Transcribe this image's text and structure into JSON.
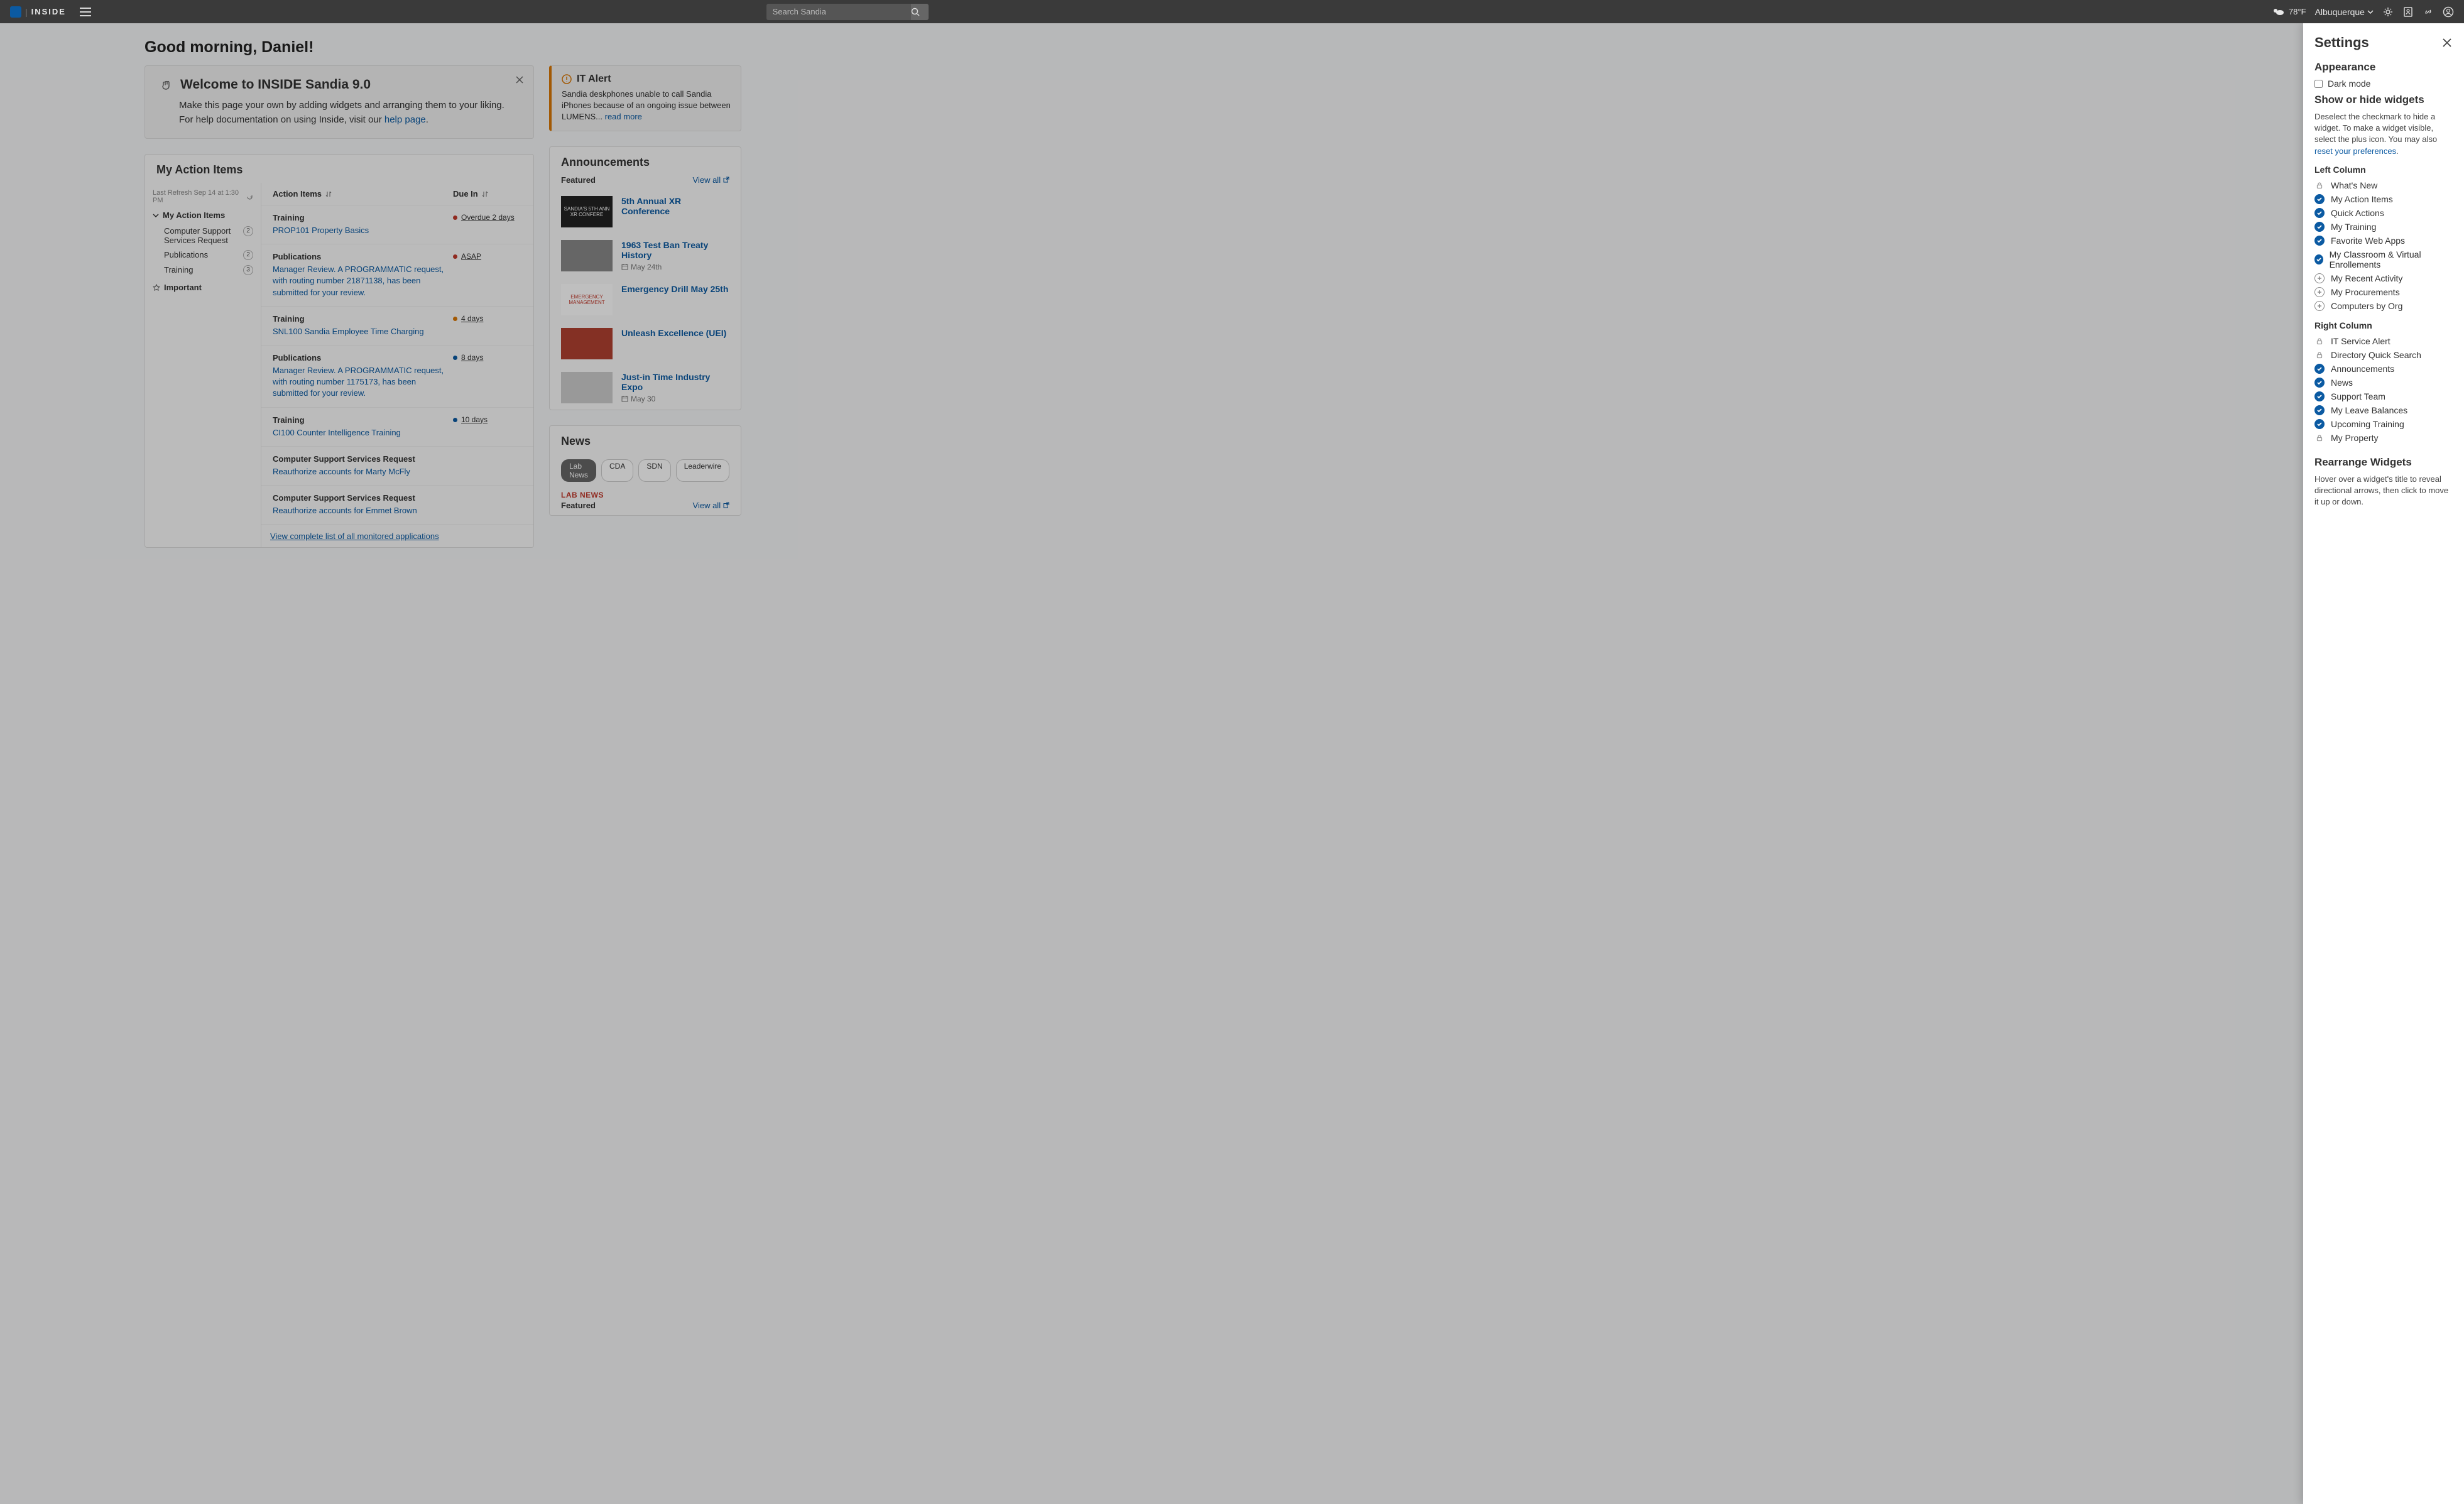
{
  "topbar": {
    "brand": "INSIDE",
    "search_placeholder": "Search Sandia",
    "temp": "78°F",
    "location": "Albuquerque"
  },
  "greeting": "Good morning, Daniel!",
  "welcome": {
    "title": "Welcome to INSIDE Sandia 9.0",
    "body_prefix": "Make this page your own by adding widgets and arranging them to your liking. For help documentation on using Inside, visit our ",
    "body_link": "help page",
    "body_suffix": "."
  },
  "alert": {
    "title": "IT Alert",
    "body_prefix": "Sandia deskphones unable to call Sandia iPhones because of an ongoing issue between LUMENS... ",
    "read_more": "read more"
  },
  "action_items": {
    "title": "My Action Items",
    "refresh": "Last Refresh Sep 14 at 1:30 PM",
    "group_title": "My Action Items",
    "categories": [
      {
        "label": "Computer Support Services Request",
        "count": "2"
      },
      {
        "label": "Publications",
        "count": "2"
      },
      {
        "label": "Training",
        "count": "3"
      }
    ],
    "important": "Important",
    "col_items": "Action Items",
    "col_due": "Due In",
    "rows": [
      {
        "cat": "Training",
        "title": "PROP101 Property Basics",
        "due": "Overdue 2 days",
        "dot": "#c0392b"
      },
      {
        "cat": "Publications",
        "title": "Manager Review. A PROGRAMMATIC request, with routing number 21871138, has been submitted for your review.",
        "due": "ASAP",
        "dot": "#c0392b"
      },
      {
        "cat": "Training",
        "title": "SNL100 Sandia Employee Time Charging",
        "due": "4 days",
        "dot": "#d97706"
      },
      {
        "cat": "Publications",
        "title": "Manager Review. A PROGRAMMATIC request, with routing number 1175173, has been submitted for your review.",
        "due": "8 days",
        "dot": "#0b5aa2"
      },
      {
        "cat": "Training",
        "title": "CI100 Counter Intelligence Training",
        "due": "10 days",
        "dot": "#0b5aa2"
      },
      {
        "cat": "Computer Support Services Request",
        "title": "Reauthorize accounts for Marty McFly",
        "due": "",
        "dot": ""
      },
      {
        "cat": "Computer Support Services Request",
        "title": "Reauthorize accounts for Emmet Brown",
        "due": "",
        "dot": ""
      }
    ],
    "view_all": "View complete list of all monitored applications"
  },
  "announcements": {
    "title": "Announcements",
    "featured": "Featured",
    "view_all": "View all",
    "items": [
      {
        "title": "5th Annual XR Conference",
        "date": "",
        "thumb": "SANDIA'S 5TH ANN XR CONFERE"
      },
      {
        "title": "1963 Test Ban Treaty History",
        "date": "May 24th",
        "thumb": ""
      },
      {
        "title": "Emergency Drill May 25th",
        "date": "",
        "thumb": "EMERGENCY MANAGEMENT"
      },
      {
        "title": "Unleash Excellence (UEI)",
        "date": "",
        "thumb": ""
      },
      {
        "title": "Just-in Time Industry Expo",
        "date": "May 30",
        "thumb": ""
      }
    ]
  },
  "news": {
    "title": "News",
    "tabs": [
      "Lab News",
      "CDA",
      "SDN",
      "Leaderwire"
    ],
    "label": "LAB NEWS",
    "featured": "Featured",
    "view_all": "View all"
  },
  "settings": {
    "title": "Settings",
    "appearance": "Appearance",
    "dark_mode": "Dark mode",
    "show_hide": "Show or hide widgets",
    "help_prefix": "Deselect the checkmark to hide a widget. To make a widget visible, select the plus icon. You may also ",
    "help_link": "reset your preferences",
    "help_suffix": ".",
    "left_label": "Left Column",
    "left": [
      {
        "icon": "lock",
        "label": "What's New"
      },
      {
        "icon": "check",
        "label": "My Action Items"
      },
      {
        "icon": "check",
        "label": "Quick Actions"
      },
      {
        "icon": "check",
        "label": "My Training"
      },
      {
        "icon": "check",
        "label": "Favorite Web Apps"
      },
      {
        "icon": "check",
        "label": "My Classroom & Virtual Enrollements"
      },
      {
        "icon": "plus",
        "label": "My Recent Activity"
      },
      {
        "icon": "plus",
        "label": "My Procurements"
      },
      {
        "icon": "plus",
        "label": "Computers by Org"
      }
    ],
    "right_label": "Right Column",
    "right": [
      {
        "icon": "lock",
        "label": "IT Service Alert"
      },
      {
        "icon": "lock",
        "label": "Directory Quick Search"
      },
      {
        "icon": "check",
        "label": "Announcements"
      },
      {
        "icon": "check",
        "label": "News"
      },
      {
        "icon": "check",
        "label": "Support Team"
      },
      {
        "icon": "check",
        "label": "My Leave Balances"
      },
      {
        "icon": "check",
        "label": "Upcoming Training"
      },
      {
        "icon": "lock",
        "label": "My Property"
      }
    ],
    "rearrange": "Rearrange Widgets",
    "rearrange_help": "Hover over a widget's title to reveal directional arrows, then click to move it up or down."
  }
}
